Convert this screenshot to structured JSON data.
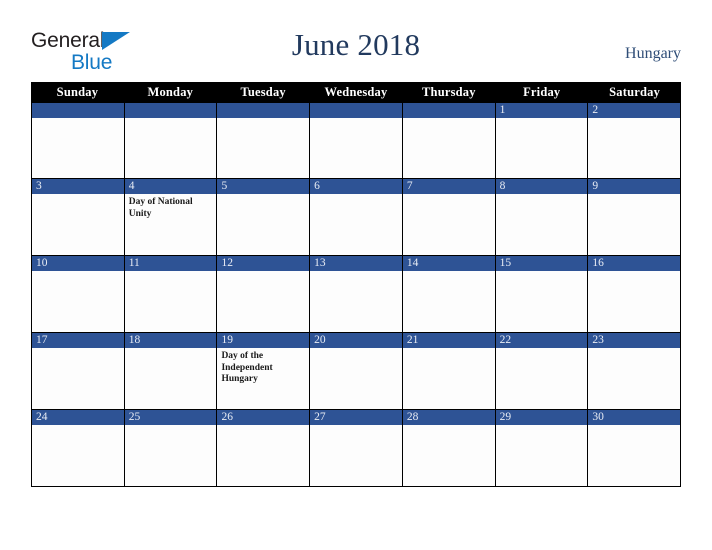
{
  "brand": {
    "name_part1": "General",
    "name_part2": "Blue",
    "triangle_color": "#1479c4",
    "text_color": "#231f20"
  },
  "header": {
    "title": "June 2018",
    "country": "Hungary",
    "title_color": "#223a5e",
    "country_color": "#2f4d77"
  },
  "calendar": {
    "weekdays": [
      "Sunday",
      "Monday",
      "Tuesday",
      "Wednesday",
      "Thursday",
      "Friday",
      "Saturday"
    ],
    "header_bg": "#000000",
    "header_text_color": "#ffffff",
    "day_bar_color": "#2e5395",
    "day_number_color": "#e8ecf4",
    "cell_bg": "#fdfdfd",
    "grid_line_color": "#000000",
    "weeks": [
      [
        {
          "num": "",
          "events": []
        },
        {
          "num": "",
          "events": []
        },
        {
          "num": "",
          "events": []
        },
        {
          "num": "",
          "events": []
        },
        {
          "num": "",
          "events": []
        },
        {
          "num": "1",
          "events": []
        },
        {
          "num": "2",
          "events": []
        }
      ],
      [
        {
          "num": "3",
          "events": []
        },
        {
          "num": "4",
          "events": [
            "Day of National Unity"
          ]
        },
        {
          "num": "5",
          "events": []
        },
        {
          "num": "6",
          "events": []
        },
        {
          "num": "7",
          "events": []
        },
        {
          "num": "8",
          "events": []
        },
        {
          "num": "9",
          "events": []
        }
      ],
      [
        {
          "num": "10",
          "events": []
        },
        {
          "num": "11",
          "events": []
        },
        {
          "num": "12",
          "events": []
        },
        {
          "num": "13",
          "events": []
        },
        {
          "num": "14",
          "events": []
        },
        {
          "num": "15",
          "events": []
        },
        {
          "num": "16",
          "events": []
        }
      ],
      [
        {
          "num": "17",
          "events": []
        },
        {
          "num": "18",
          "events": []
        },
        {
          "num": "19",
          "events": [
            "Day of the Independent Hungary"
          ]
        },
        {
          "num": "20",
          "events": []
        },
        {
          "num": "21",
          "events": []
        },
        {
          "num": "22",
          "events": []
        },
        {
          "num": "23",
          "events": []
        }
      ],
      [
        {
          "num": "24",
          "events": []
        },
        {
          "num": "25",
          "events": []
        },
        {
          "num": "26",
          "events": []
        },
        {
          "num": "27",
          "events": []
        },
        {
          "num": "28",
          "events": []
        },
        {
          "num": "29",
          "events": []
        },
        {
          "num": "30",
          "events": []
        }
      ]
    ]
  }
}
